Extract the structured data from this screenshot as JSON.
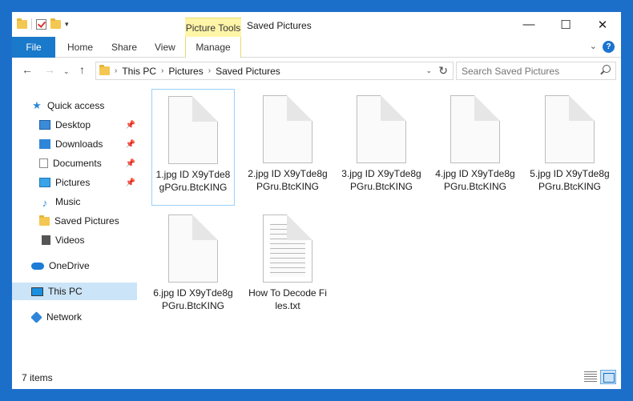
{
  "window": {
    "title": "Saved Pictures",
    "contextual_tab_group": "Picture Tools",
    "controls": {
      "minimize": "—",
      "maximize": "☐",
      "close": "✕"
    }
  },
  "ribbon": {
    "tabs": [
      {
        "label": "File"
      },
      {
        "label": "Home"
      },
      {
        "label": "Share"
      },
      {
        "label": "View"
      },
      {
        "label": "Manage"
      }
    ],
    "expand_icon": "chevron-down-icon",
    "help_label": "?"
  },
  "address_bar": {
    "crumbs": [
      "This PC",
      "Pictures",
      "Saved Pictures"
    ]
  },
  "search": {
    "placeholder": "Search Saved Pictures"
  },
  "nav_pane": {
    "items": [
      {
        "label": "Quick access",
        "icon": "star-icon"
      },
      {
        "label": "Desktop",
        "icon": "desktop-icon",
        "pinned": true
      },
      {
        "label": "Downloads",
        "icon": "downloads-icon",
        "pinned": true
      },
      {
        "label": "Documents",
        "icon": "documents-icon",
        "pinned": true
      },
      {
        "label": "Pictures",
        "icon": "pictures-icon",
        "pinned": true
      },
      {
        "label": "Music",
        "icon": "music-icon"
      },
      {
        "label": "Saved Pictures",
        "icon": "folder-icon"
      },
      {
        "label": "Videos",
        "icon": "videos-icon"
      },
      {
        "label": "OneDrive",
        "icon": "cloud-icon"
      },
      {
        "label": "This PC",
        "icon": "pc-icon",
        "selected": true
      },
      {
        "label": "Network",
        "icon": "network-icon"
      }
    ]
  },
  "files": [
    {
      "name": "1.jpg ID X9yTde8gPGru.BtcKING"
    },
    {
      "name": "2.jpg ID X9yTde8gPGru.BtcKING"
    },
    {
      "name": "3.jpg ID X9yTde8gPGru.BtcKING"
    },
    {
      "name": "4.jpg ID X9yTde8gPGru.BtcKING"
    },
    {
      "name": "5.jpg ID X9yTde8gPGru.BtcKING"
    },
    {
      "name": "6.jpg ID X9yTde8gPGru.BtcKING"
    },
    {
      "name": "How To Decode Files.txt"
    }
  ],
  "status": {
    "item_count": "7 items"
  },
  "colors": {
    "accent": "#1979ca",
    "picture_tools": "#fff5a8",
    "selection": "#cce4f7"
  }
}
